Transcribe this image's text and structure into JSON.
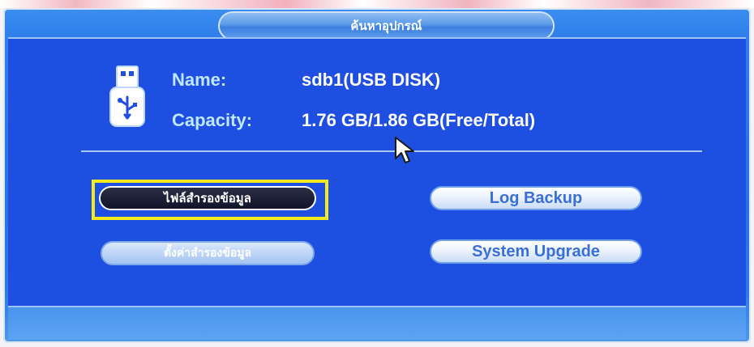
{
  "window": {
    "title": "ค้นหาอุปกรณ์"
  },
  "device": {
    "icon": "usb-drive-icon",
    "name_label": "Name:",
    "name_value": "sdb1(USB DISK)",
    "capacity_label": "Capacity:",
    "capacity_value": "1.76 GB/1.86 GB(Free/Total)"
  },
  "buttons": {
    "backup_files": "ไฟล์สำรองข้อมูล",
    "backup_settings": "ตั้งค่าสำรองข้อมูล",
    "log_backup": "Log Backup",
    "system_upgrade": "System Upgrade"
  },
  "colors": {
    "panel_blue": "#1f4fe0",
    "highlight_yellow": "#f4ea1c"
  }
}
